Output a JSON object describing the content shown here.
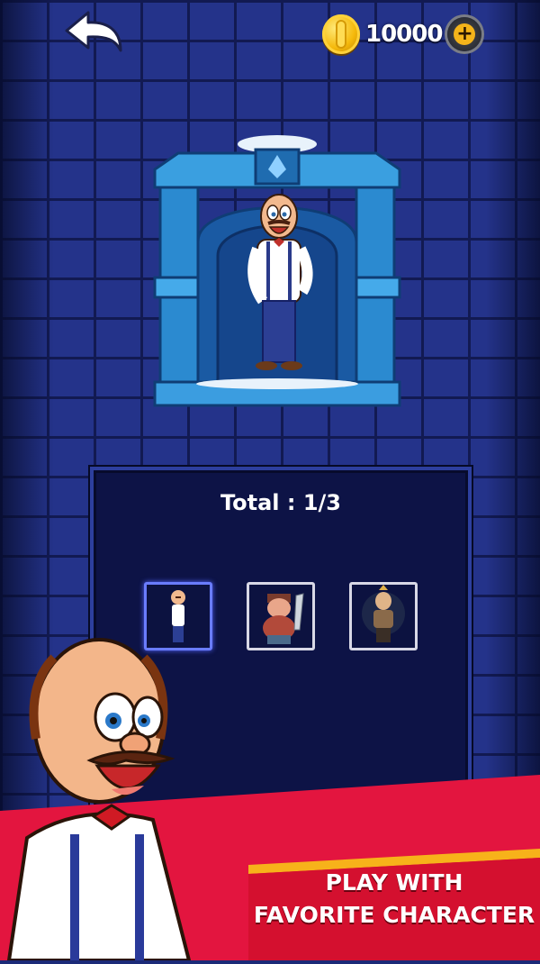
{
  "hud": {
    "back_icon": "back-arrow-icon",
    "coin_icon": "gold-coin-icon",
    "coins": "10000",
    "add_icon": "plus-icon"
  },
  "scene": {
    "window_color": "#2e8fd6",
    "wall_color": "#24338a"
  },
  "panel": {
    "title": "Total : 1/3",
    "characters": [
      {
        "name_icon": "butler-character-icon",
        "selected": true
      },
      {
        "name_icon": "pirate-character-icon",
        "selected": false
      },
      {
        "name_icon": "warrior-character-icon",
        "selected": false
      }
    ]
  },
  "banner": {
    "line1": "PLAY WITH",
    "line2": "FAVORITE CHARACTER",
    "accent": "#e3153f",
    "stripe": "#f7b21a"
  }
}
